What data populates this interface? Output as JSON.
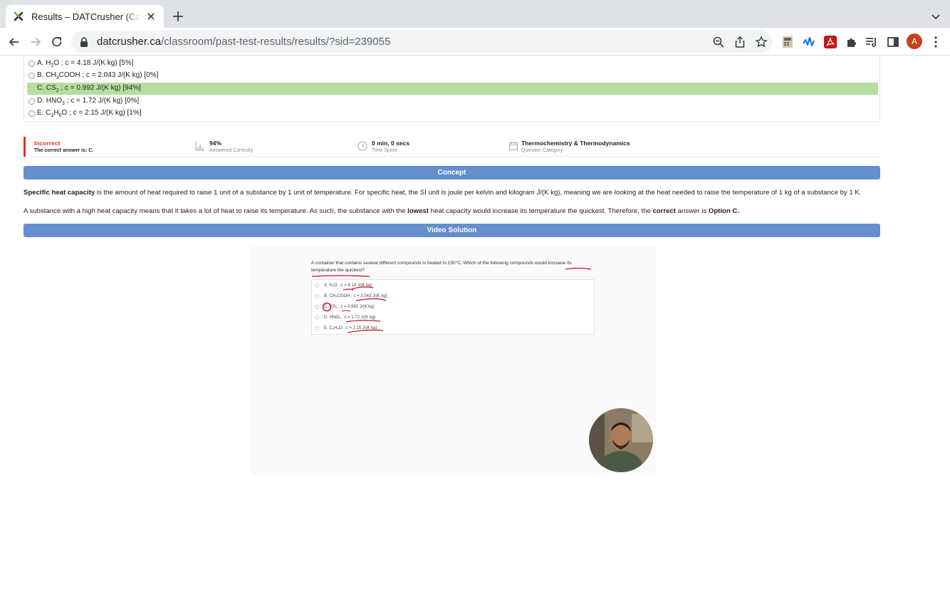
{
  "browser": {
    "tab_title": "Results – DATCrusher (Canadian",
    "url_host": "datcrusher.ca",
    "url_path": "/classroom/past-test-results/results/?sid=239055",
    "avatar_letter": "A"
  },
  "answers": [
    {
      "letter": "A.",
      "pre": "H",
      "sub": "2",
      "post": "O ; c = 4.18 J/(K kg) [5%]",
      "correct": false
    },
    {
      "letter": "B.",
      "pre": "CH",
      "sub": "3",
      "post": "COOH ; c = 2.043 J/(K kg) [0%]",
      "correct": false
    },
    {
      "letter": "C.",
      "pre": "CS",
      "sub": "2",
      "post": " ; c = 0.992 J/(K kg) [94%]",
      "correct": true
    },
    {
      "letter": "D.",
      "pre": "HNO",
      "sub": "3",
      "post": " ; c = 1.72 J/(K kg) [0%]",
      "correct": false
    },
    {
      "letter": "E.",
      "pre": "C",
      "sub": "3",
      "mid": "H",
      "sub2": "6",
      "post": "O ; c = 2.15 J/(K kg) [1%]",
      "correct": false
    }
  ],
  "result": {
    "status": "Incorrect",
    "correct_answer": "The correct answer is: C.",
    "percent": "94%",
    "percent_label": "Answered Correctly",
    "time": "0 min, 0 secs",
    "time_label": "Time Spent",
    "category": "Thermochemistry & Thermodynamics",
    "category_label": "Question Category"
  },
  "concept": {
    "header": "Concept",
    "p1_bold": "Specific heat capacity",
    "p1_rest": " is the amount of heat required to raise 1 unit of a substance by 1 unit of temperature. For specific heat, the SI unit is joule per kelvin and kilogram J/(K kg), meaning we are looking at the heat needed to raise the temperature of 1 kg of a substance by 1 K.",
    "p2_a": "A substance with a high heat capacity means that it takes a lot of heat to raise its temperature. As such, the substance with the ",
    "p2_b": "lowest",
    "p2_c": " heat capacity would increase its temperature the quickest. Therefore, the ",
    "p2_d": "correct",
    "p2_e": " answer is ",
    "p2_f": "Option C."
  },
  "video": {
    "header": "Video Solution",
    "question_line1": "A container that contains several different compounds is heated to 150°C. Which of the following compounds would increase its",
    "question_line2": "temperature the quickest?",
    "choices": [
      "A. H₂O ; c = 4.18 J/(K kg)",
      "B. CH₃COOH ; c = 2.043 J/(K kg)",
      "C. CS₂ ; c = 0.992 J/(K kg)",
      "D. HNO₃ ; c = 1.72 J/(K kg)",
      "E. C₃H₆O ; c = 2.15 J/(K kg)"
    ]
  },
  "colors": {
    "section_bar": "#658ecf",
    "correct_row": "#b7dd9f",
    "incorrect": "#d9342b"
  }
}
